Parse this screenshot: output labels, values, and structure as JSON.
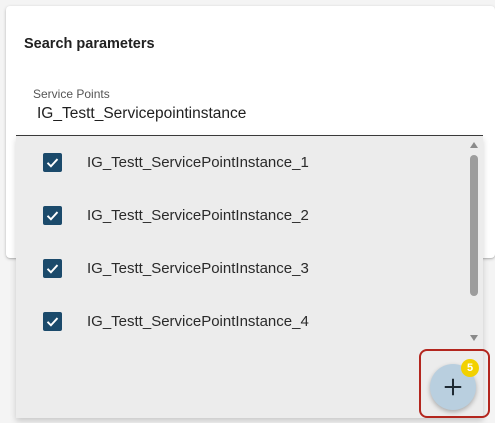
{
  "panel": {
    "title": "Search parameters"
  },
  "service_points_field": {
    "label": "Service Points",
    "value": "IG_Testt_Servicepointinstance"
  },
  "options": [
    {
      "label": "IG_Testt_ServicePointInstance_1",
      "checked": true
    },
    {
      "label": "IG_Testt_ServicePointInstance_2",
      "checked": true
    },
    {
      "label": "IG_Testt_ServicePointInstance_3",
      "checked": true
    },
    {
      "label": "IG_Testt_ServicePointInstance_4",
      "checked": true
    }
  ],
  "fab": {
    "icon": "plus-icon",
    "badge_count": "5"
  },
  "colors": {
    "checkbox": "#1b4a6b",
    "fab": "#b9cfdf",
    "badge": "#f2d100",
    "highlight": "#b3261e"
  }
}
